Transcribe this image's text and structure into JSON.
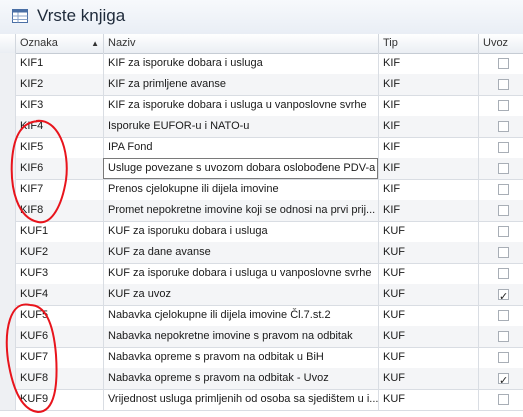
{
  "window": {
    "title": "Vrste knjiga",
    "icon": "table-icon"
  },
  "grid": {
    "columns": [
      "Oznaka",
      "Naziv",
      "Tip",
      "Uvoz"
    ],
    "sort_indicator": "▲",
    "rows": [
      {
        "oznaka": "KIF1",
        "naziv": "KIF za isporuke dobara i usluga",
        "tip": "KIF",
        "uvoz": false
      },
      {
        "oznaka": "KIF2",
        "naziv": "KIF za primljene avanse",
        "tip": "KIF",
        "uvoz": false
      },
      {
        "oznaka": "KIF3",
        "naziv": "KIF za isporuke dobara i usluga u vanposlovne svrhe",
        "tip": "KIF",
        "uvoz": false
      },
      {
        "oznaka": "KIF4",
        "naziv": "Isporuke EUFOR-u i NATO-u",
        "tip": "KIF",
        "uvoz": false
      },
      {
        "oznaka": "KIF5",
        "naziv": "IPA Fond",
        "tip": "KIF",
        "uvoz": false
      },
      {
        "oznaka": "KIF6",
        "naziv": "Usluge povezane s uvozom dobara oslobođene PDV-a",
        "tip": "KIF",
        "uvoz": false,
        "selected_cell": "naziv"
      },
      {
        "oznaka": "KIF7",
        "naziv": "Prenos cjelokupne ili dijela imovine",
        "tip": "KIF",
        "uvoz": false
      },
      {
        "oznaka": "KIF8",
        "naziv": "Promet nepokretne imovine koji se odnosi na prvi prij...",
        "tip": "KIF",
        "uvoz": false
      },
      {
        "oznaka": "KUF1",
        "naziv": "KUF za isporuku dobara i usluga",
        "tip": "KUF",
        "uvoz": false
      },
      {
        "oznaka": "KUF2",
        "naziv": "KUF za dane avanse",
        "tip": "KUF",
        "uvoz": false
      },
      {
        "oznaka": "KUF3",
        "naziv": "KUF za isporuke dobara i usluga u vanposlovne svrhe",
        "tip": "KUF",
        "uvoz": false
      },
      {
        "oznaka": "KUF4",
        "naziv": "KUF za uvoz",
        "tip": "KUF",
        "uvoz": true
      },
      {
        "oznaka": "KUF5",
        "naziv": "Nabavka cjelokupne ili dijela imovine Čl.7.st.2",
        "tip": "KUF",
        "uvoz": false
      },
      {
        "oznaka": "KUF6",
        "naziv": "Nabavka nepokretne imovine s pravom na odbitak",
        "tip": "KUF",
        "uvoz": false
      },
      {
        "oznaka": "KUF7",
        "naziv": "Nabavka opreme s pravom na odbitak u BiH",
        "tip": "KUF",
        "uvoz": false
      },
      {
        "oznaka": "KUF8",
        "naziv": "Nabavka opreme s pravom na odbitak - Uvoz",
        "tip": "KUF",
        "uvoz": true
      },
      {
        "oznaka": "KUF9",
        "naziv": "Vrijednost usluga primljenih od osoba sa sjedištem u i...",
        "tip": "KUF",
        "uvoz": false
      }
    ]
  },
  "annotation_color": "#e8141c"
}
